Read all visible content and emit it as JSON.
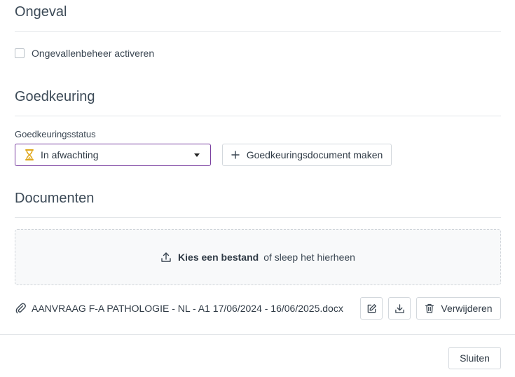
{
  "accident": {
    "title": "Ongeval",
    "checkbox_label": "Ongevallenbeheer activeren",
    "checked": false
  },
  "approval": {
    "title": "Goedkeuring",
    "status_label": "Goedkeuringsstatus",
    "status_value": "In afwachting",
    "status_icon": "hourglass-icon",
    "create_button": "Goedkeuringsdocument maken"
  },
  "documents": {
    "title": "Documenten",
    "dropzone_choose": "Kies een bestand",
    "dropzone_rest": "of sleep het hierheen",
    "files": [
      {
        "name": "AANVRAAG F-A PATHOLOGIE - NL - A1 17/06/2024 - 16/06/2025.docx"
      }
    ],
    "delete_button": "Verwijderen"
  },
  "footer": {
    "close_button": "Sluiten"
  },
  "colors": {
    "accent_border": "#7a3fa0",
    "hourglass": "#e0a81f",
    "text": "#2f3a45"
  }
}
